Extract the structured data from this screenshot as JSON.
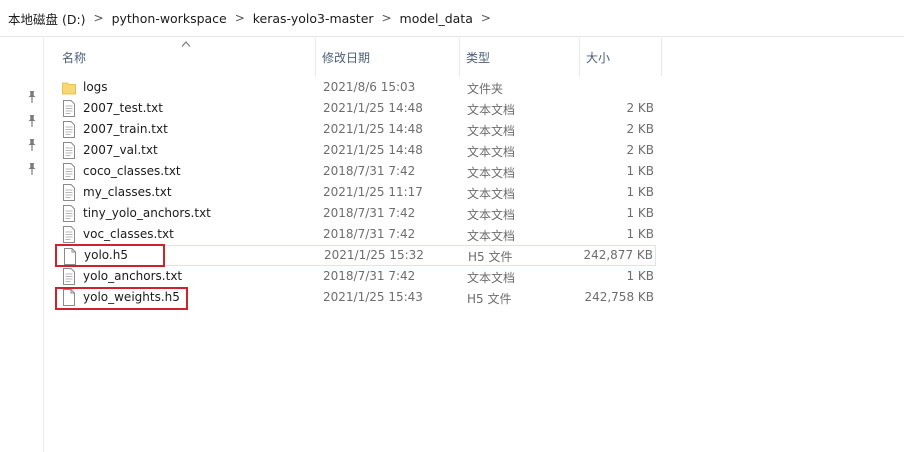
{
  "breadcrumb": [
    "本地磁盘 (D:)",
    "python-workspace",
    "keras-yolo3-master",
    "model_data"
  ],
  "columns": {
    "name": "名称",
    "date": "修改日期",
    "type": "类型",
    "size": "大小"
  },
  "files": [
    {
      "name": "logs",
      "date": "2021/8/6 15:03",
      "type": "文件夹",
      "size": "",
      "icon": "folder-icon"
    },
    {
      "name": "2007_test.txt",
      "date": "2021/1/25 14:48",
      "type": "文本文档",
      "size": "2 KB",
      "icon": "text-file-icon"
    },
    {
      "name": "2007_train.txt",
      "date": "2021/1/25 14:48",
      "type": "文本文档",
      "size": "2 KB",
      "icon": "text-file-icon"
    },
    {
      "name": "2007_val.txt",
      "date": "2021/1/25 14:48",
      "type": "文本文档",
      "size": "2 KB",
      "icon": "text-file-icon"
    },
    {
      "name": "coco_classes.txt",
      "date": "2018/7/31 7:42",
      "type": "文本文档",
      "size": "1 KB",
      "icon": "text-file-icon"
    },
    {
      "name": "my_classes.txt",
      "date": "2021/1/25 11:17",
      "type": "文本文档",
      "size": "1 KB",
      "icon": "text-file-icon"
    },
    {
      "name": "tiny_yolo_anchors.txt",
      "date": "2018/7/31 7:42",
      "type": "文本文档",
      "size": "1 KB",
      "icon": "text-file-icon"
    },
    {
      "name": "voc_classes.txt",
      "date": "2018/7/31 7:42",
      "type": "文本文档",
      "size": "1 KB",
      "icon": "text-file-icon"
    },
    {
      "name": "yolo.h5",
      "date": "2021/1/25 15:32",
      "type": "H5 文件",
      "size": "242,877 KB",
      "icon": "blank-file-icon"
    },
    {
      "name": "yolo_anchors.txt",
      "date": "2018/7/31 7:42",
      "type": "文本文档",
      "size": "1 KB",
      "icon": "text-file-icon"
    },
    {
      "name": "yolo_weights.h5",
      "date": "2021/1/25 15:43",
      "type": "H5 文件",
      "size": "242,758 KB",
      "icon": "blank-file-icon"
    }
  ],
  "selected_row": 8,
  "highlighted_rows": [
    8,
    10
  ],
  "colors": {
    "highlight": "#d0222a",
    "selection_border": "#cde8ff",
    "header_text": "#4c607a",
    "folder": "#f8d775"
  }
}
